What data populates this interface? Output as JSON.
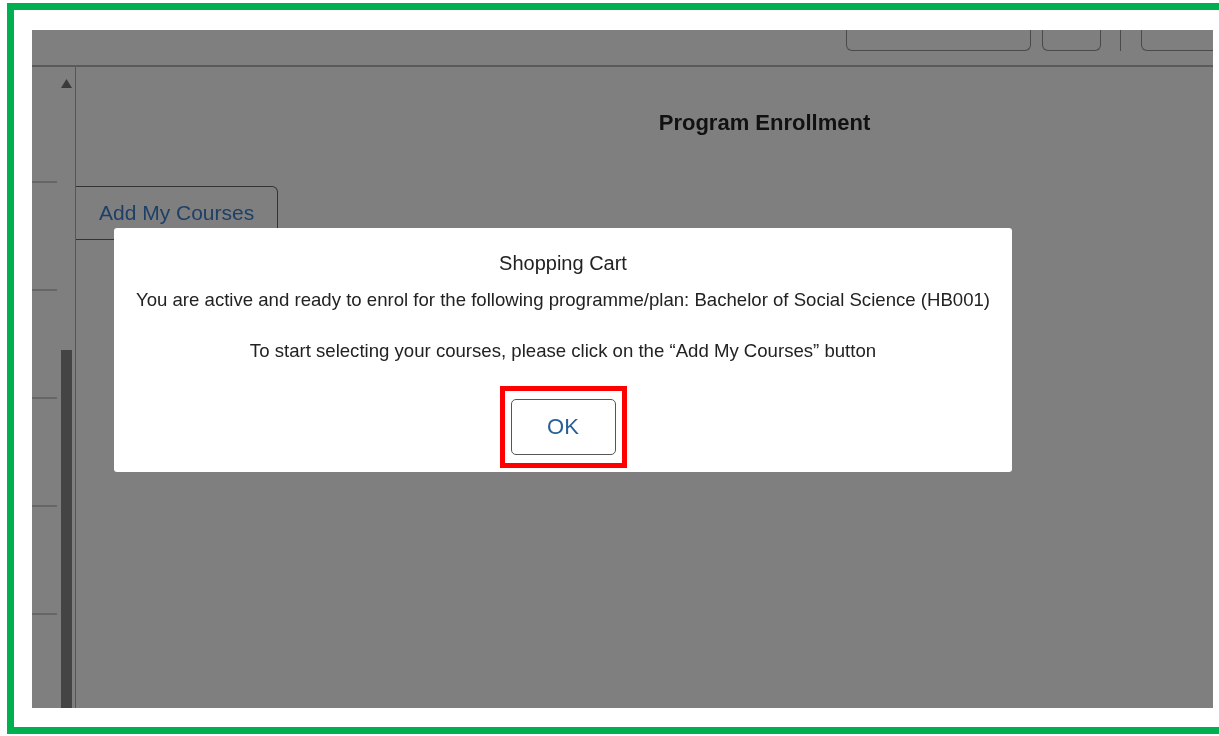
{
  "header": {
    "buttons": [
      {
        "kind": "wide"
      },
      {
        "kind": "narrow"
      },
      {
        "kind": "cut"
      }
    ]
  },
  "page": {
    "title": "Program Enrollment",
    "add_button": {
      "label": "Add My Courses"
    }
  },
  "dialog": {
    "title": "Shopping Cart",
    "message": "You are active and ready to enrol for the following programme/plan: Bachelor of Social Science (HB001)",
    "instruction": "To start selecting your courses, please click on the “Add My Courses” button",
    "ok_button": {
      "label": "OK",
      "highlighted": true
    }
  }
}
